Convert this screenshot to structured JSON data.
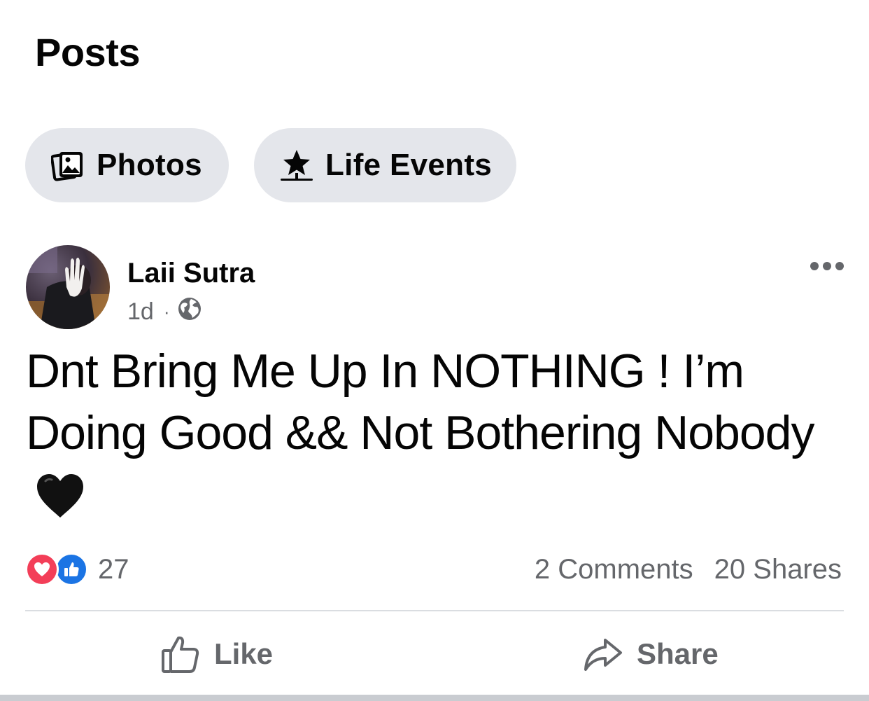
{
  "section": {
    "title": "Posts"
  },
  "filters": [
    {
      "label": "Photos",
      "icon": "photos-icon"
    },
    {
      "label": "Life Events",
      "icon": "life-event-flag-icon"
    }
  ],
  "post": {
    "author": "Laii Sutra",
    "time": "1d",
    "separator": "·",
    "audience_icon": "globe-icon",
    "text": "Dnt Bring Me Up In NOTHING ! I’m Doing Good && Not Bothering Nobody",
    "emoji": "black-heart-emoji",
    "reactions": {
      "types": [
        "love",
        "like"
      ],
      "count": "27"
    },
    "comments_label": "2 Comments",
    "shares_label": "20 Shares",
    "actions": {
      "like_label": "Like",
      "share_label": "Share"
    }
  },
  "colors": {
    "pill_background": "#e4e6eb",
    "secondary_text": "#65676b",
    "love_red": "#f33e58",
    "like_blue": "#1b74e4"
  }
}
